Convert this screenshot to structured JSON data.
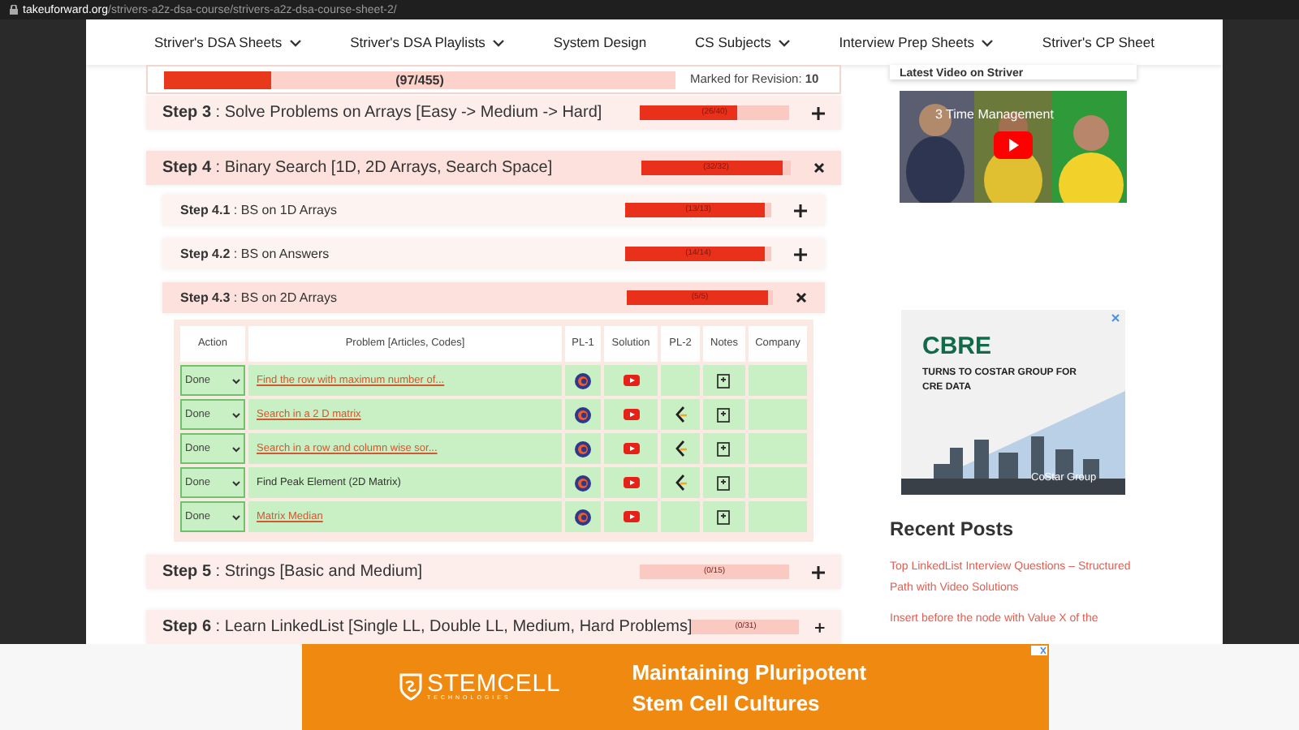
{
  "browser": {
    "url_host": "takeuforward.org",
    "url_path": "/strivers-a2z-dsa-course/strivers-a2z-dsa-course-sheet-2/"
  },
  "nav": [
    {
      "label": "Striver's DSA Sheets",
      "dropdown": true
    },
    {
      "label": "Striver's DSA Playlists",
      "dropdown": true
    },
    {
      "label": "System Design",
      "dropdown": false
    },
    {
      "label": "CS Subjects",
      "dropdown": true
    },
    {
      "label": "Interview Prep Sheets",
      "dropdown": true
    },
    {
      "label": "Striver's CP Sheet",
      "dropdown": false
    }
  ],
  "progress": {
    "level": 0.21,
    "count": "(97/455)",
    "revision": "Marked for Revision: **10**"
  },
  "steps": [
    {
      "title": "**Step 3** : Solve Problems on Arrays [Easy -> Medium -> Hard]",
      "count": "(26/40)",
      "level": 0.65,
      "expanded": false,
      "sub": false
    },
    {
      "title": "**Step 4** : Binary Search [1D, 2D Arrays, Search Space]",
      "count": "(32/32)",
      "level": 0.95,
      "expanded": true,
      "sub": false
    },
    {
      "title": "**Step 4.1** : BS on 1D Arrays",
      "count": "(13/13)",
      "level": 0.95,
      "expanded": false,
      "sub": true
    },
    {
      "title": "**Step 4.2** : BS on Answers",
      "count": "(14/14)",
      "level": 0.95,
      "expanded": false,
      "sub": true
    },
    {
      "title": "**Step 4.3** : BS on 2D Arrays",
      "count": "(5/5)",
      "level": 0.97,
      "expanded": true,
      "sub": true,
      "table": {
        "columns": [
          "Action",
          "Problem [Articles, Codes]",
          "PL-1",
          "Solution",
          "PL-2",
          "Notes",
          "Company"
        ],
        "rows": [
          {
            "action": "Done",
            "problem": "Find the row with maximum number of...",
            "linked": true,
            "pl2": false
          },
          {
            "action": "Done",
            "problem": "Search in a 2 D matrix",
            "linked": true,
            "pl2": true
          },
          {
            "action": "Done",
            "problem": "Search in a row and column wise sor...",
            "linked": true,
            "pl2": true
          },
          {
            "action": "Done",
            "problem": "Find Peak Element (2D Matrix)",
            "linked": false,
            "pl2": true
          },
          {
            "action": "Done",
            "problem": "Matrix Median",
            "linked": true,
            "pl2": false
          }
        ]
      }
    },
    {
      "title": "**Step 5** : Strings [Basic and Medium]",
      "count": "(0/15)",
      "level": 0,
      "expanded": false,
      "sub": false
    },
    {
      "title": "**Step 6** : Learn LinkedList [Single LL, Double LL, Medium, Hard Problems]",
      "count": "(0/31)",
      "level": 0,
      "expanded": false,
      "sub": false
    }
  ],
  "sidebar": {
    "video_card_title": "Latest Video on Striver",
    "video": {
      "kind": "picture",
      "title": "3 Time Management"
    },
    "ad": {
      "kind": "picture",
      "brand": "CBRE",
      "headline": "TURNS TO COSTAR GROUP FOR CRE DATA",
      "sponsor": "CoStar Group"
    },
    "recent_title": "Recent Posts",
    "posts": [
      "Top LinkedList Interview Questions – Structured Path with Video Solutions",
      "Insert before the node with Value X of the"
    ]
  },
  "bottom_ad": {
    "brand": "STEMCELL",
    "brand_sub": "TECHNOLOGIES",
    "headline": "Maintaining Pluripotent Stem Cell Cultures"
  }
}
